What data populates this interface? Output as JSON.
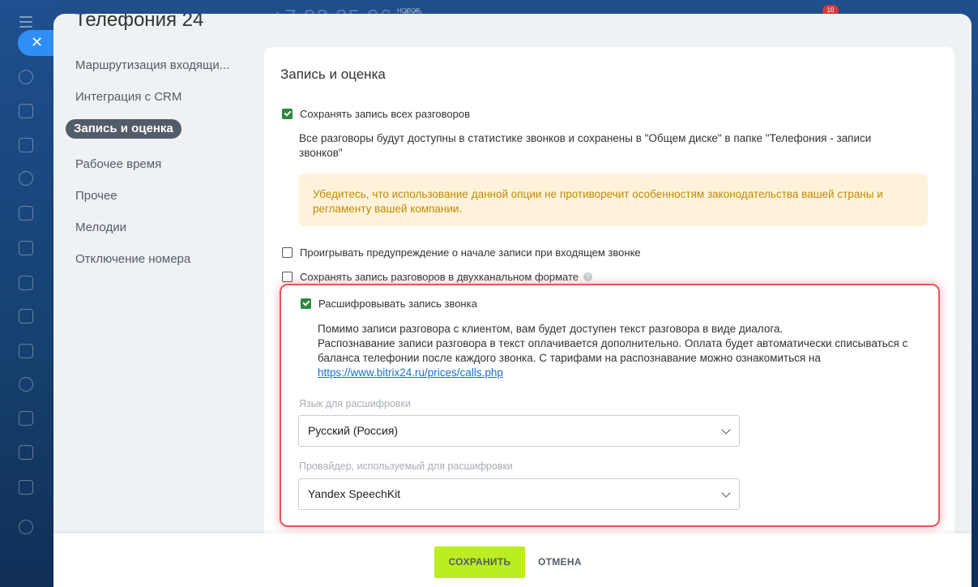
{
  "app": {
    "phone_number_bg": "+7 83 25 96 42",
    "new_label": "НОВОЕ",
    "notification_count": "10"
  },
  "sidebar": {
    "icons": [
      "chat-icon",
      "messages-icon",
      "feed-icon",
      "hexagon-icon",
      "calendar-icon",
      "document-icon",
      "screen-icon",
      "card-icon",
      "mail-icon",
      "users-icon",
      "tasks-icon",
      "planner-icon",
      "storage-icon",
      "settings-icon"
    ]
  },
  "panel": {
    "title": "Телефония 24",
    "menu": [
      {
        "label": "Маршрутизация входящи...",
        "active": false
      },
      {
        "label": "Интеграция с CRM",
        "active": false
      },
      {
        "label": "Запись и оценка",
        "active": true
      },
      {
        "label": "Рабочее время",
        "active": false
      },
      {
        "label": "Прочее",
        "active": false
      },
      {
        "label": "Мелодии",
        "active": false
      },
      {
        "label": "Отключение номера",
        "active": false
      }
    ]
  },
  "content": {
    "section_title": "Запись и оценка",
    "save_all": {
      "label": "Сохранять запись всех разговоров",
      "checked": true
    },
    "save_all_desc": "Все разговоры будут доступны в статистике звонков и сохранены в \"Общем диске\" в папке \"Телефония - записи звонков\"",
    "warning": "Убедитесь, что использование данной опции не противоречит особенностям законодательства вашей страны и регламенту вашей компании.",
    "play_warning": {
      "label": "Проигрывать предупреждение о начале записи при входящем звонке",
      "checked": false
    },
    "two_channel": {
      "label": "Сохранять запись разговоров в двухканальном формате",
      "checked": false
    },
    "transcribe": {
      "label": "Расшифровывать запись звонка",
      "checked": true
    },
    "transcribe_desc_1": "Помимо записи разговора с клиентом, вам будет доступен текст разговора в виде диалога.",
    "transcribe_desc_2": "Распознавание записи разговора в текст оплачивается дополнительно. Оплата будет автоматически списываться с баланса телефонии после каждого звонка. С тарифами на распознавание можно ознакомиться на",
    "transcribe_link": "https://www.bitrix24.ru/prices/calls.php",
    "language_label": "Язык для расшифровки",
    "language_value": "Русский (Россия)",
    "provider_label": "Провайдер, используемый для расшифровки",
    "provider_value": "Yandex SpeechKit"
  },
  "footer": {
    "save_label": "СОХРАНИТЬ",
    "cancel_label": "ОТМЕНА"
  },
  "colors": {
    "accent_green": "#bbed21",
    "checkbox_green": "#2a8a3e",
    "highlight_red": "#e8535b",
    "warning_bg": "#fef3da",
    "warning_text": "#c28a00",
    "link_blue": "#1b6fcb"
  }
}
